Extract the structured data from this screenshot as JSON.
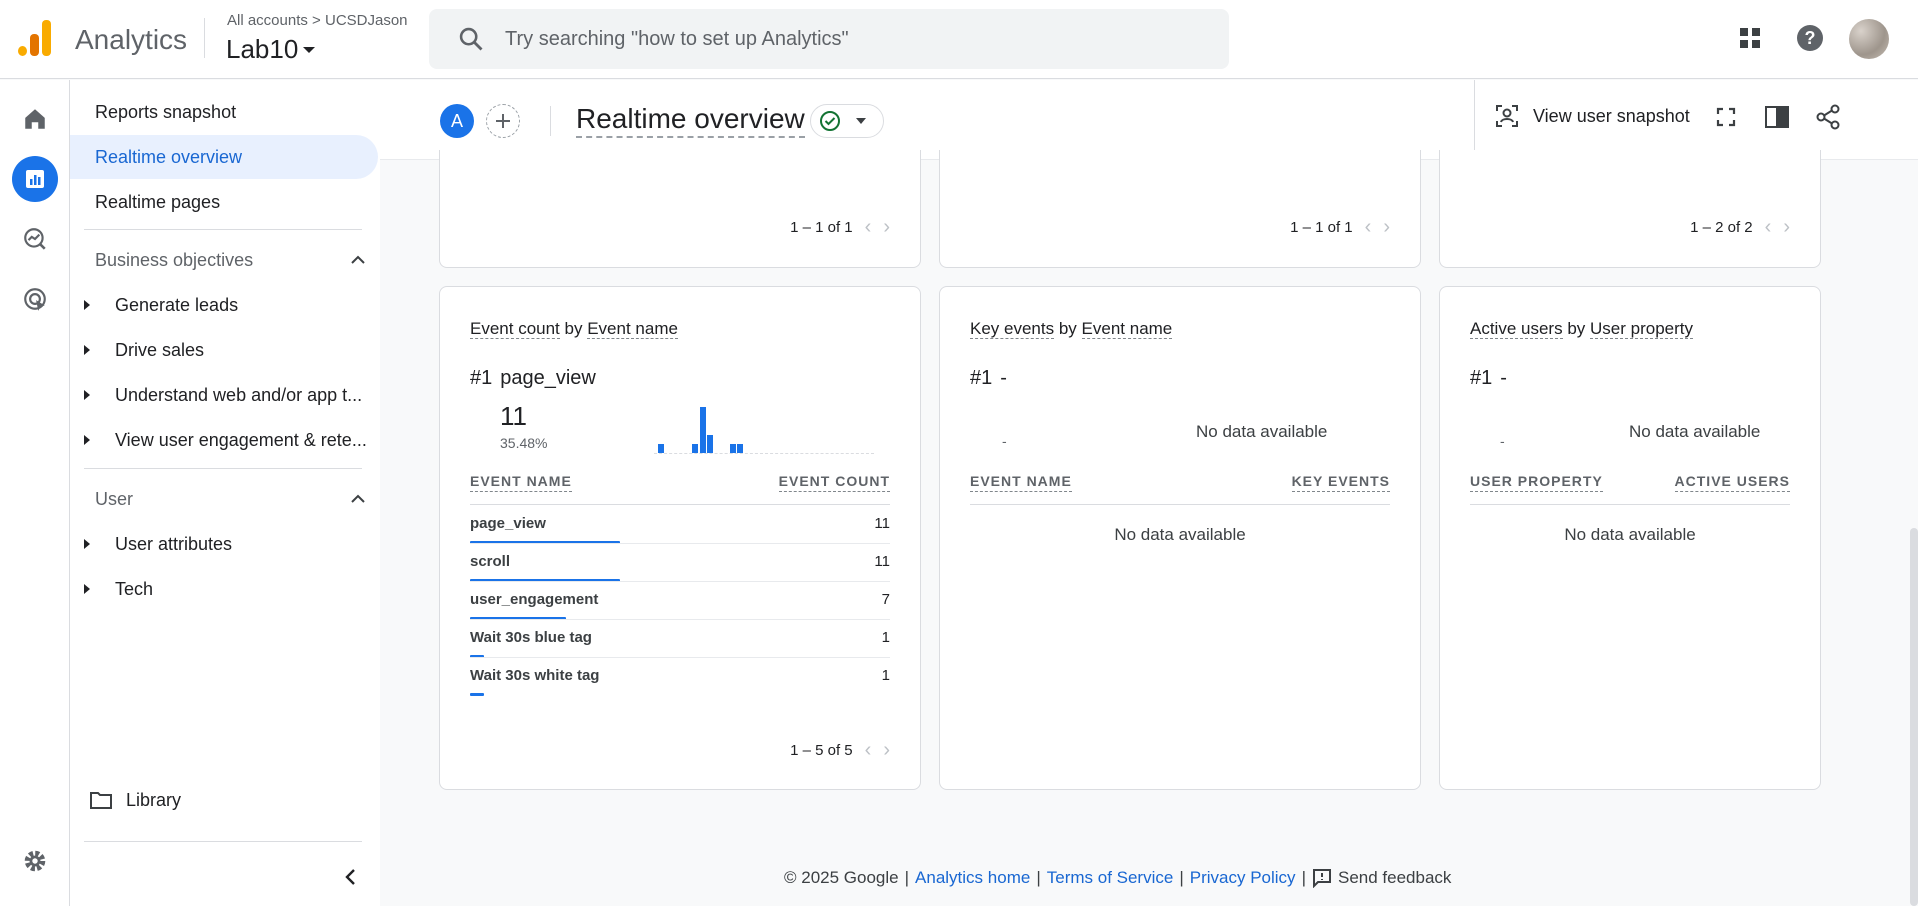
{
  "app": {
    "name": "Analytics"
  },
  "header": {
    "crumb_all": "All accounts",
    "crumb_sep": ">",
    "crumb_account": "UCSDJason",
    "property": "Lab10",
    "search_placeholder": "Try searching \"how to set up Analytics\""
  },
  "icons": {
    "apps": "apps-grid-icon",
    "help": "help-icon",
    "accent": "#1a73e8"
  },
  "nav": {
    "reports_snapshot": "Reports snapshot",
    "realtime_overview": "Realtime overview",
    "realtime_pages": "Realtime pages",
    "business_objectives": "Business objectives",
    "bo_items": [
      "Generate leads",
      "Drive sales",
      "Understand web and/or app t...",
      "View user engagement & rete..."
    ],
    "user": "User",
    "user_items": [
      "User attributes",
      "Tech"
    ],
    "library": "Library"
  },
  "report": {
    "compare_badge": "A",
    "title": "Realtime overview",
    "view_user_snapshot": "View user snapshot"
  },
  "top_cards": [
    {
      "pager": "1 – 1 of 1"
    },
    {
      "pager": "1 – 1 of 1"
    },
    {
      "pager": "1 – 2 of 2"
    }
  ],
  "event_card": {
    "metric": "Event count",
    "by": "by",
    "dimension": "Event name",
    "rank": "#1",
    "top_name": "page_view",
    "top_value": "11",
    "top_pct": "35.48%",
    "col1": "EVENT NAME",
    "col2": "EVENT COUNT",
    "rows": [
      {
        "name": "page_view",
        "value": "11",
        "share": 1.0
      },
      {
        "name": "scroll",
        "value": "11",
        "share": 1.0
      },
      {
        "name": "user_engagement",
        "value": "7",
        "share": 0.64
      },
      {
        "name": "Wait 30s blue tag",
        "value": "1",
        "share": 0.09
      },
      {
        "name": "Wait 30s white tag",
        "value": "1",
        "share": 0.09
      }
    ],
    "pager": "1 – 5 of 5",
    "spark_values": [
      2,
      0,
      0,
      0,
      2,
      10,
      4,
      0,
      2,
      2
    ]
  },
  "key_card": {
    "metric": "Key events",
    "by": "by",
    "dimension": "Event name",
    "rank": "#1",
    "top_name": "-",
    "dash": "-",
    "nodata": "No data available",
    "col1": "EVENT NAME",
    "col2": "KEY EVENTS",
    "table_nodata": "No data available"
  },
  "users_card": {
    "metric": "Active users",
    "by": "by",
    "dimension": "User property",
    "rank": "#1",
    "top_name": "-",
    "dash": "-",
    "nodata": "No data available",
    "col1": "USER PROPERTY",
    "col2": "ACTIVE USERS",
    "table_nodata": "No data available"
  },
  "footer": {
    "copyright": "© 2025 Google",
    "sep": "|",
    "analytics_home": "Analytics home",
    "terms": "Terms of Service",
    "privacy": "Privacy Policy",
    "feedback": "Send feedback"
  }
}
